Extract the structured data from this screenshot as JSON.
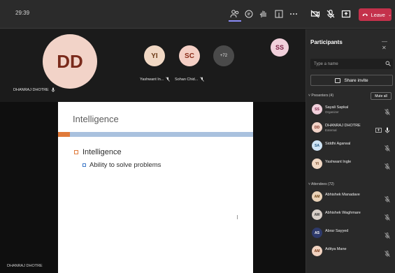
{
  "call": {
    "timer": "29:39"
  },
  "toolbar": {
    "leave_label": "Leave",
    "icons": [
      "people-icon",
      "chat-icon",
      "raise-hand-icon",
      "rooms-icon",
      "more-icon",
      "camera-off-icon",
      "mic-off-icon",
      "share-icon"
    ]
  },
  "stage": {
    "main_tile": {
      "initials": "DD",
      "name": "DHANRAJ DHOTRE"
    },
    "tiles": [
      {
        "initials": "YI",
        "name": "Yashwant In..."
      },
      {
        "initials": "SC",
        "name": "Sohan Chid..."
      }
    ],
    "more_count": "+72",
    "ss_tile": {
      "initials": "SS"
    },
    "presenter_name": "DHANRAJ DHOTRE"
  },
  "slide": {
    "title": "Intelligence",
    "bullet1": "Intelligence",
    "bullet2": "Ability to solve problems"
  },
  "panel": {
    "title": "Participants",
    "search_placeholder": "Type a name",
    "share_label": "Share invite",
    "presenters_header": "Presenters (4)",
    "mute_all": "Mute all",
    "attendees_header": "Attendees (72)",
    "presenters": [
      {
        "initials": "SS",
        "name": "Sayali Sapkal",
        "role": "Organizer",
        "color": "#f1d0db",
        "text": "#7b2043"
      },
      {
        "initials": "DD",
        "name": "DHANRAJ DHOTRE",
        "role": "External",
        "color": "#f2d3c8",
        "text": "#7a2a1b"
      },
      {
        "initials": "SA",
        "name": "Siddhi Agarwal",
        "role": "",
        "color": "#cfe4f5",
        "text": "#1b4f7a"
      },
      {
        "initials": "YI",
        "name": "Yashwant Ingle",
        "role": "",
        "color": "#f1d8c4",
        "text": "#6b3a16"
      }
    ],
    "attendees": [
      {
        "initials": "AM",
        "name": "Abhishek Manadave",
        "color": "#e9d2b8",
        "text": "#6a3f12"
      },
      {
        "initials": "AW",
        "name": "Abhishek Waghmare",
        "color": "#d8cfc8",
        "text": "#3a3a3a"
      },
      {
        "initials": "AS",
        "name": "Abrar Sayyed",
        "color": "#2e3a6b",
        "text": "#ffffff"
      },
      {
        "initials": "AM",
        "name": "Aditya Mane",
        "color": "#f0d2c0",
        "text": "#7a3a18"
      }
    ]
  }
}
